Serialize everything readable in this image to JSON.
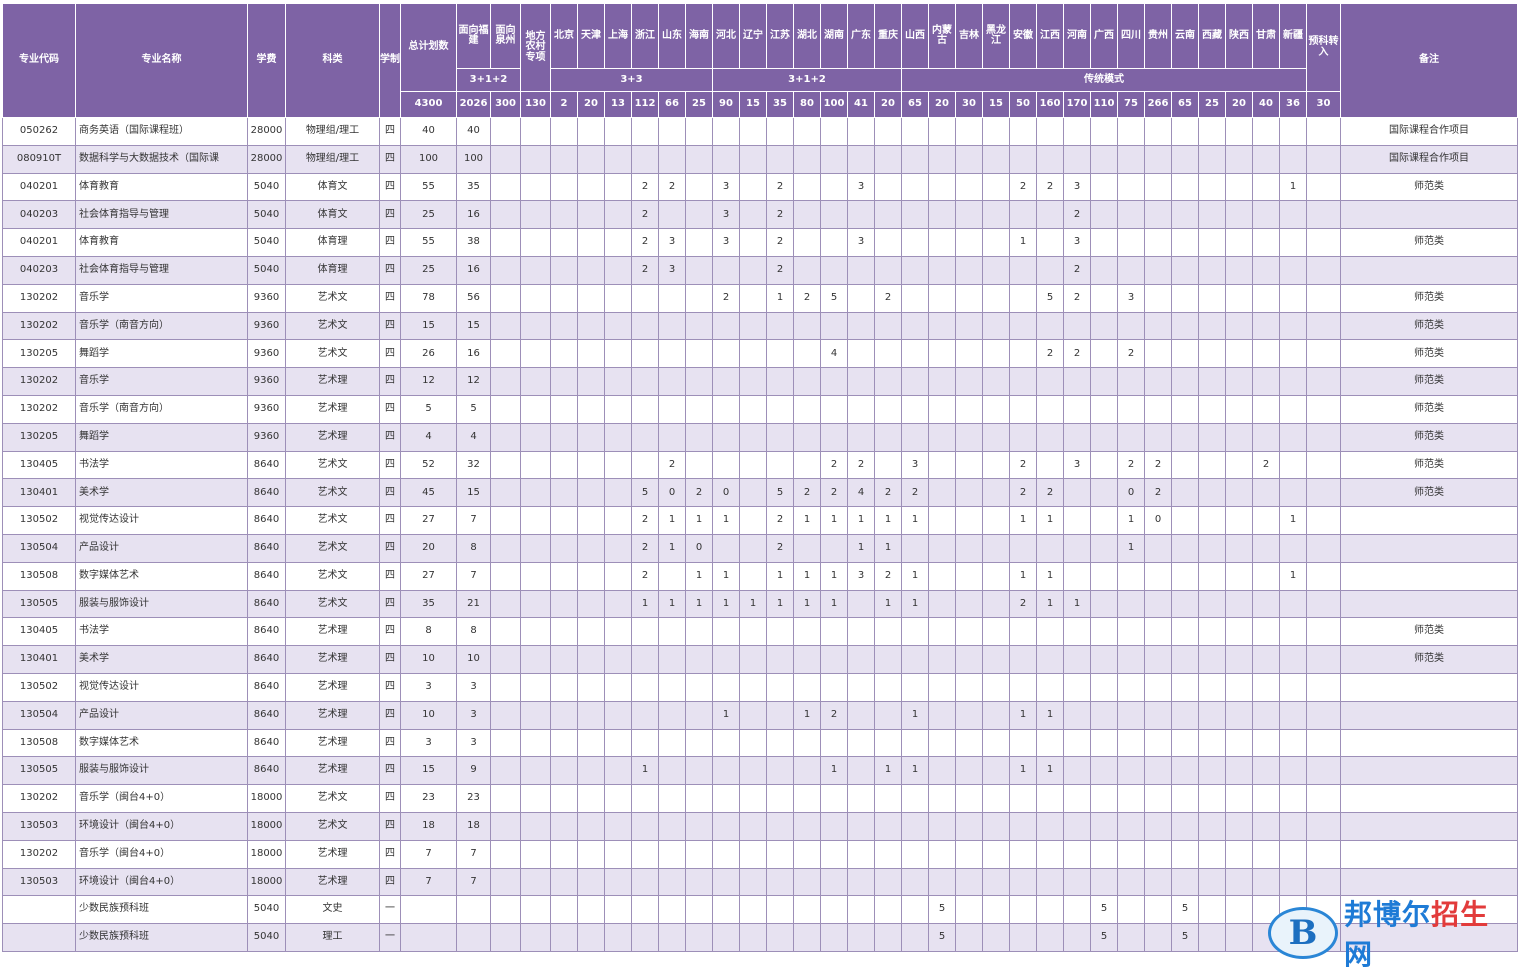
{
  "header": {
    "code": "专业代码",
    "name": "专业名称",
    "fee": "学费",
    "category": "科类",
    "duration": "学制",
    "total": "总计划数",
    "fujian": "面向福建",
    "quanzhou": "面向泉州",
    "rural": "地方农村专项",
    "provinces": [
      "北京",
      "天津",
      "上海",
      "浙江",
      "山东",
      "海南",
      "河北",
      "辽宁",
      "江苏",
      "湖北",
      "湖南",
      "广东",
      "重庆",
      "山西",
      "内蒙古",
      "吉林",
      "黑龙江",
      "安徽",
      "江西",
      "河南",
      "广西",
      "四川",
      "贵州",
      "云南",
      "西藏",
      "陕西",
      "甘肃",
      "新疆"
    ],
    "prep": "预科转入",
    "remark": "备注",
    "groups": {
      "g1": "3+1+2",
      "g2": "3+3",
      "g3": "3+1+2",
      "g4": "传统模式"
    },
    "totals": {
      "total": "4300",
      "fujian": "2026",
      "quanzhou": "300",
      "rural": "130",
      "provinces": [
        "2",
        "20",
        "13",
        "112",
        "66",
        "25",
        "90",
        "15",
        "35",
        "80",
        "100",
        "41",
        "20",
        "65",
        "20",
        "30",
        "15",
        "50",
        "160",
        "170",
        "110",
        "75",
        "266",
        "65",
        "25",
        "20",
        "40",
        "36"
      ],
      "prep": "30"
    }
  },
  "rows": [
    {
      "code": "050262",
      "name": "商务英语（国际课程班）",
      "fee": "28000",
      "category": "物理组/理工",
      "duration": "四",
      "total": "40",
      "fujian": "40",
      "quanzhou": "",
      "rural": "",
      "p": {},
      "prep": "",
      "remark": "国际课程合作项目"
    },
    {
      "code": "080910T",
      "name": "数据科学与大数据技术（国际课",
      "fee": "28000",
      "category": "物理组/理工",
      "duration": "四",
      "total": "100",
      "fujian": "100",
      "quanzhou": "",
      "rural": "",
      "p": {},
      "prep": "",
      "remark": "国际课程合作项目"
    },
    {
      "code": "040201",
      "name": "体育教育",
      "fee": "5040",
      "category": "体育文",
      "duration": "四",
      "total": "55",
      "fujian": "35",
      "quanzhou": "",
      "rural": "",
      "p": {
        "3": "2",
        "4": "2",
        "6": "3",
        "8": "2",
        "11": "3",
        "17": "2",
        "18": "2",
        "19": "3",
        "27": "1"
      },
      "prep": "",
      "remark": "师范类"
    },
    {
      "code": "040203",
      "name": "社会体育指导与管理",
      "fee": "5040",
      "category": "体育文",
      "duration": "四",
      "total": "25",
      "fujian": "16",
      "quanzhou": "",
      "rural": "",
      "p": {
        "3": "2",
        "6": "3",
        "8": "2",
        "19": "2"
      },
      "prep": "",
      "remark": ""
    },
    {
      "code": "040201",
      "name": "体育教育",
      "fee": "5040",
      "category": "体育理",
      "duration": "四",
      "total": "55",
      "fujian": "38",
      "quanzhou": "",
      "rural": "",
      "p": {
        "3": "2",
        "4": "3",
        "6": "3",
        "8": "2",
        "11": "3",
        "17": "1",
        "19": "3"
      },
      "prep": "",
      "remark": "师范类"
    },
    {
      "code": "040203",
      "name": "社会体育指导与管理",
      "fee": "5040",
      "category": "体育理",
      "duration": "四",
      "total": "25",
      "fujian": "16",
      "quanzhou": "",
      "rural": "",
      "p": {
        "3": "2",
        "4": "3",
        "8": "2",
        "19": "2"
      },
      "prep": "",
      "remark": ""
    },
    {
      "code": "130202",
      "name": "音乐学",
      "fee": "9360",
      "category": "艺术文",
      "duration": "四",
      "total": "78",
      "fujian": "56",
      "quanzhou": "",
      "rural": "",
      "p": {
        "6": "2",
        "8": "1",
        "9": "2",
        "10": "5",
        "12": "2",
        "18": "5",
        "19": "2",
        "21": "3"
      },
      "prep": "",
      "remark": "师范类"
    },
    {
      "code": "130202",
      "name": "音乐学（南音方向）",
      "fee": "9360",
      "category": "艺术文",
      "duration": "四",
      "total": "15",
      "fujian": "15",
      "quanzhou": "",
      "rural": "",
      "p": {},
      "prep": "",
      "remark": "师范类"
    },
    {
      "code": "130205",
      "name": "舞蹈学",
      "fee": "9360",
      "category": "艺术文",
      "duration": "四",
      "total": "26",
      "fujian": "16",
      "quanzhou": "",
      "rural": "",
      "p": {
        "10": "4",
        "18": "2",
        "19": "2",
        "21": "2"
      },
      "prep": "",
      "remark": "师范类"
    },
    {
      "code": "130202",
      "name": "音乐学",
      "fee": "9360",
      "category": "艺术理",
      "duration": "四",
      "total": "12",
      "fujian": "12",
      "quanzhou": "",
      "rural": "",
      "p": {},
      "prep": "",
      "remark": "师范类"
    },
    {
      "code": "130202",
      "name": "音乐学（南音方向）",
      "fee": "9360",
      "category": "艺术理",
      "duration": "四",
      "total": "5",
      "fujian": "5",
      "quanzhou": "",
      "rural": "",
      "p": {},
      "prep": "",
      "remark": "师范类"
    },
    {
      "code": "130205",
      "name": "舞蹈学",
      "fee": "9360",
      "category": "艺术理",
      "duration": "四",
      "total": "4",
      "fujian": "4",
      "quanzhou": "",
      "rural": "",
      "p": {},
      "prep": "",
      "remark": "师范类"
    },
    {
      "code": "130405",
      "name": "书法学",
      "fee": "8640",
      "category": "艺术文",
      "duration": "四",
      "total": "52",
      "fujian": "32",
      "quanzhou": "",
      "rural": "",
      "p": {
        "4": "2",
        "10": "2",
        "11": "2",
        "13": "3",
        "17": "2",
        "19": "3",
        "21": "2",
        "22": "2",
        "26": "2"
      },
      "prep": "",
      "remark": "师范类"
    },
    {
      "code": "130401",
      "name": "美术学",
      "fee": "8640",
      "category": "艺术文",
      "duration": "四",
      "total": "45",
      "fujian": "15",
      "quanzhou": "",
      "rural": "",
      "p": {
        "3": "5",
        "4": "0",
        "5": "2",
        "6": "0",
        "8": "5",
        "9": "2",
        "10": "2",
        "11": "4",
        "12": "2",
        "13": "2",
        "17": "2",
        "18": "2",
        "21": "0",
        "22": "2"
      },
      "prep": "",
      "remark": "师范类"
    },
    {
      "code": "130502",
      "name": "视觉传达设计",
      "fee": "8640",
      "category": "艺术文",
      "duration": "四",
      "total": "27",
      "fujian": "7",
      "quanzhou": "",
      "rural": "",
      "p": {
        "3": "2",
        "4": "1",
        "5": "1",
        "6": "1",
        "8": "2",
        "9": "1",
        "10": "1",
        "11": "1",
        "12": "1",
        "13": "1",
        "17": "1",
        "18": "1",
        "21": "1",
        "22": "0",
        "27": "1"
      },
      "prep": "",
      "remark": ""
    },
    {
      "code": "130504",
      "name": "产品设计",
      "fee": "8640",
      "category": "艺术文",
      "duration": "四",
      "total": "20",
      "fujian": "8",
      "quanzhou": "",
      "rural": "",
      "p": {
        "3": "2",
        "4": "1",
        "5": "0",
        "8": "2",
        "11": "1",
        "12": "1",
        "21": "1"
      },
      "prep": "",
      "remark": ""
    },
    {
      "code": "130508",
      "name": "数字媒体艺术",
      "fee": "8640",
      "category": "艺术文",
      "duration": "四",
      "total": "27",
      "fujian": "7",
      "quanzhou": "",
      "rural": "",
      "p": {
        "3": "2",
        "5": "1",
        "6": "1",
        "8": "1",
        "9": "1",
        "10": "1",
        "11": "3",
        "12": "2",
        "13": "1",
        "17": "1",
        "18": "1",
        "27": "1"
      },
      "prep": "",
      "remark": ""
    },
    {
      "code": "130505",
      "name": "服装与服饰设计",
      "fee": "8640",
      "category": "艺术文",
      "duration": "四",
      "total": "35",
      "fujian": "21",
      "quanzhou": "",
      "rural": "",
      "p": {
        "3": "1",
        "4": "1",
        "5": "1",
        "6": "1",
        "7": "1",
        "8": "1",
        "9": "1",
        "10": "1",
        "12": "1",
        "13": "1",
        "17": "2",
        "18": "1",
        "19": "1"
      },
      "prep": "",
      "remark": ""
    },
    {
      "code": "130405",
      "name": "书法学",
      "fee": "8640",
      "category": "艺术理",
      "duration": "四",
      "total": "8",
      "fujian": "8",
      "quanzhou": "",
      "rural": "",
      "p": {},
      "prep": "",
      "remark": "师范类"
    },
    {
      "code": "130401",
      "name": "美术学",
      "fee": "8640",
      "category": "艺术理",
      "duration": "四",
      "total": "10",
      "fujian": "10",
      "quanzhou": "",
      "rural": "",
      "p": {},
      "prep": "",
      "remark": "师范类"
    },
    {
      "code": "130502",
      "name": "视觉传达设计",
      "fee": "8640",
      "category": "艺术理",
      "duration": "四",
      "total": "3",
      "fujian": "3",
      "quanzhou": "",
      "rural": "",
      "p": {},
      "prep": "",
      "remark": ""
    },
    {
      "code": "130504",
      "name": "产品设计",
      "fee": "8640",
      "category": "艺术理",
      "duration": "四",
      "total": "10",
      "fujian": "3",
      "quanzhou": "",
      "rural": "",
      "p": {
        "6": "1",
        "9": "1",
        "10": "2",
        "13": "1",
        "17": "1",
        "18": "1"
      },
      "prep": "",
      "remark": ""
    },
    {
      "code": "130508",
      "name": "数字媒体艺术",
      "fee": "8640",
      "category": "艺术理",
      "duration": "四",
      "total": "3",
      "fujian": "3",
      "quanzhou": "",
      "rural": "",
      "p": {},
      "prep": "",
      "remark": ""
    },
    {
      "code": "130505",
      "name": "服装与服饰设计",
      "fee": "8640",
      "category": "艺术理",
      "duration": "四",
      "total": "15",
      "fujian": "9",
      "quanzhou": "",
      "rural": "",
      "p": {
        "3": "1",
        "10": "1",
        "12": "1",
        "13": "1",
        "17": "1",
        "18": "1"
      },
      "prep": "",
      "remark": ""
    },
    {
      "code": "130202",
      "name": "音乐学（闽台4+0）",
      "fee": "18000",
      "category": "艺术文",
      "duration": "四",
      "total": "23",
      "fujian": "23",
      "quanzhou": "",
      "rural": "",
      "p": {},
      "prep": "",
      "remark": ""
    },
    {
      "code": "130503",
      "name": "环境设计（闽台4+0）",
      "fee": "18000",
      "category": "艺术文",
      "duration": "四",
      "total": "18",
      "fujian": "18",
      "quanzhou": "",
      "rural": "",
      "p": {},
      "prep": "",
      "remark": ""
    },
    {
      "code": "130202",
      "name": "音乐学（闽台4+0）",
      "fee": "18000",
      "category": "艺术理",
      "duration": "四",
      "total": "7",
      "fujian": "7",
      "quanzhou": "",
      "rural": "",
      "p": {},
      "prep": "",
      "remark": ""
    },
    {
      "code": "130503",
      "name": "环境设计（闽台4+0）",
      "fee": "18000",
      "category": "艺术理",
      "duration": "四",
      "total": "7",
      "fujian": "7",
      "quanzhou": "",
      "rural": "",
      "p": {},
      "prep": "",
      "remark": ""
    },
    {
      "code": "",
      "name": "少数民族预科班",
      "fee": "5040",
      "category": "文史",
      "duration": "一",
      "total": "",
      "fujian": "",
      "quanzhou": "",
      "rural": "",
      "p": {
        "14": "5",
        "20": "5",
        "23": "5"
      },
      "prep": "",
      "remark": ""
    },
    {
      "code": "",
      "name": "少数民族预科班",
      "fee": "5040",
      "category": "理工",
      "duration": "一",
      "total": "",
      "fujian": "",
      "quanzhou": "",
      "rural": "",
      "p": {
        "14": "5",
        "20": "5",
        "23": "5"
      },
      "prep": "",
      "remark": ""
    }
  ],
  "watermark": {
    "logo": "B",
    "text_main": "邦博尔",
    "text_accent": "招生",
    "text_end": "网"
  },
  "colors": {
    "header_bg": "#7e63a5",
    "stripe": "#e7e2f1",
    "border": "#9d8fb8"
  }
}
